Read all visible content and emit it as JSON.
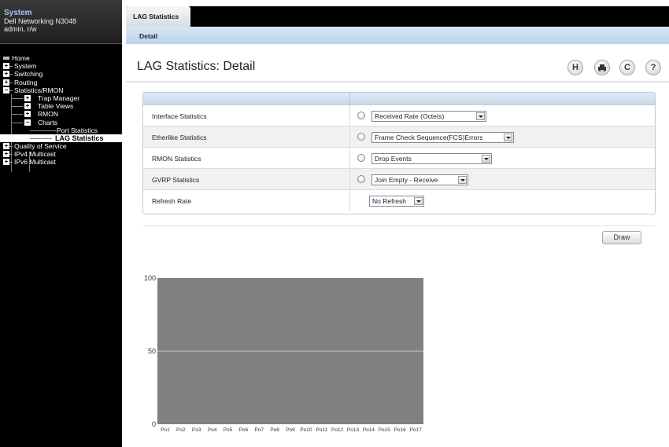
{
  "sidebar": {
    "system_title": "System",
    "model": "Dell Networking N3048",
    "user": "admin, r/w",
    "items": [
      {
        "label": "Home",
        "icon": "home-icon"
      },
      {
        "label": "System",
        "icon": "plus"
      },
      {
        "label": "Switching",
        "icon": "plus"
      },
      {
        "label": "Routing",
        "icon": "plus"
      },
      {
        "label": "Statistics/RMON",
        "icon": "minus"
      },
      {
        "label": "Trap Manager",
        "icon": "plus"
      },
      {
        "label": "Table Views",
        "icon": "plus"
      },
      {
        "label": "RMON",
        "icon": "plus"
      },
      {
        "label": "Charts",
        "icon": "minus"
      },
      {
        "label": "Port Statistics",
        "icon": "leaf"
      },
      {
        "label": "LAG Statistics",
        "icon": "leaf",
        "selected": true
      },
      {
        "label": "Quality of Service",
        "icon": "plus"
      },
      {
        "label": "IPv4 Multicast",
        "icon": "plus"
      },
      {
        "label": "IPv6 Multicast",
        "icon": "plus"
      }
    ]
  },
  "tabs": {
    "main": "LAG Statistics",
    "sub": "Detail"
  },
  "page": {
    "title": "LAG Statistics: Detail",
    "toolbar": {
      "save_icon": "save-icon",
      "print_icon": "print-icon",
      "refresh_icon": "refresh-icon",
      "help_icon": "help-icon"
    }
  },
  "form": {
    "rows": [
      {
        "label": "Interface Statistics",
        "value": "Received Rate (Octets)"
      },
      {
        "label": "Etherlike Statistics",
        "value": "Frame Check Sequence(FCS)Errors"
      },
      {
        "label": "RMON Statistics",
        "value": "Drop Events"
      },
      {
        "label": "GVRP Statistics",
        "value": "Join Empty - Receive"
      },
      {
        "label": "Refresh Rate",
        "value": "No Refresh"
      }
    ]
  },
  "draw_label": "Draw",
  "chart_data": {
    "type": "bar",
    "categories": [
      "Po1",
      "Po2",
      "Po3",
      "Po4",
      "Po5",
      "Po6",
      "Po7",
      "Po8",
      "Po9",
      "Po10",
      "Po11",
      "Po12",
      "Po13",
      "Po14",
      "Po15",
      "Po16",
      "Po17"
    ],
    "values": [
      0,
      0,
      0,
      0,
      0,
      0,
      0,
      0,
      0,
      0,
      0,
      0,
      0,
      0,
      0,
      0,
      0
    ],
    "yticks": [
      "0",
      "50",
      "100"
    ],
    "ylim": [
      0,
      100
    ],
    "grid": true,
    "plot_bg": "#808080",
    "grid_color": "#c8c8c8"
  }
}
